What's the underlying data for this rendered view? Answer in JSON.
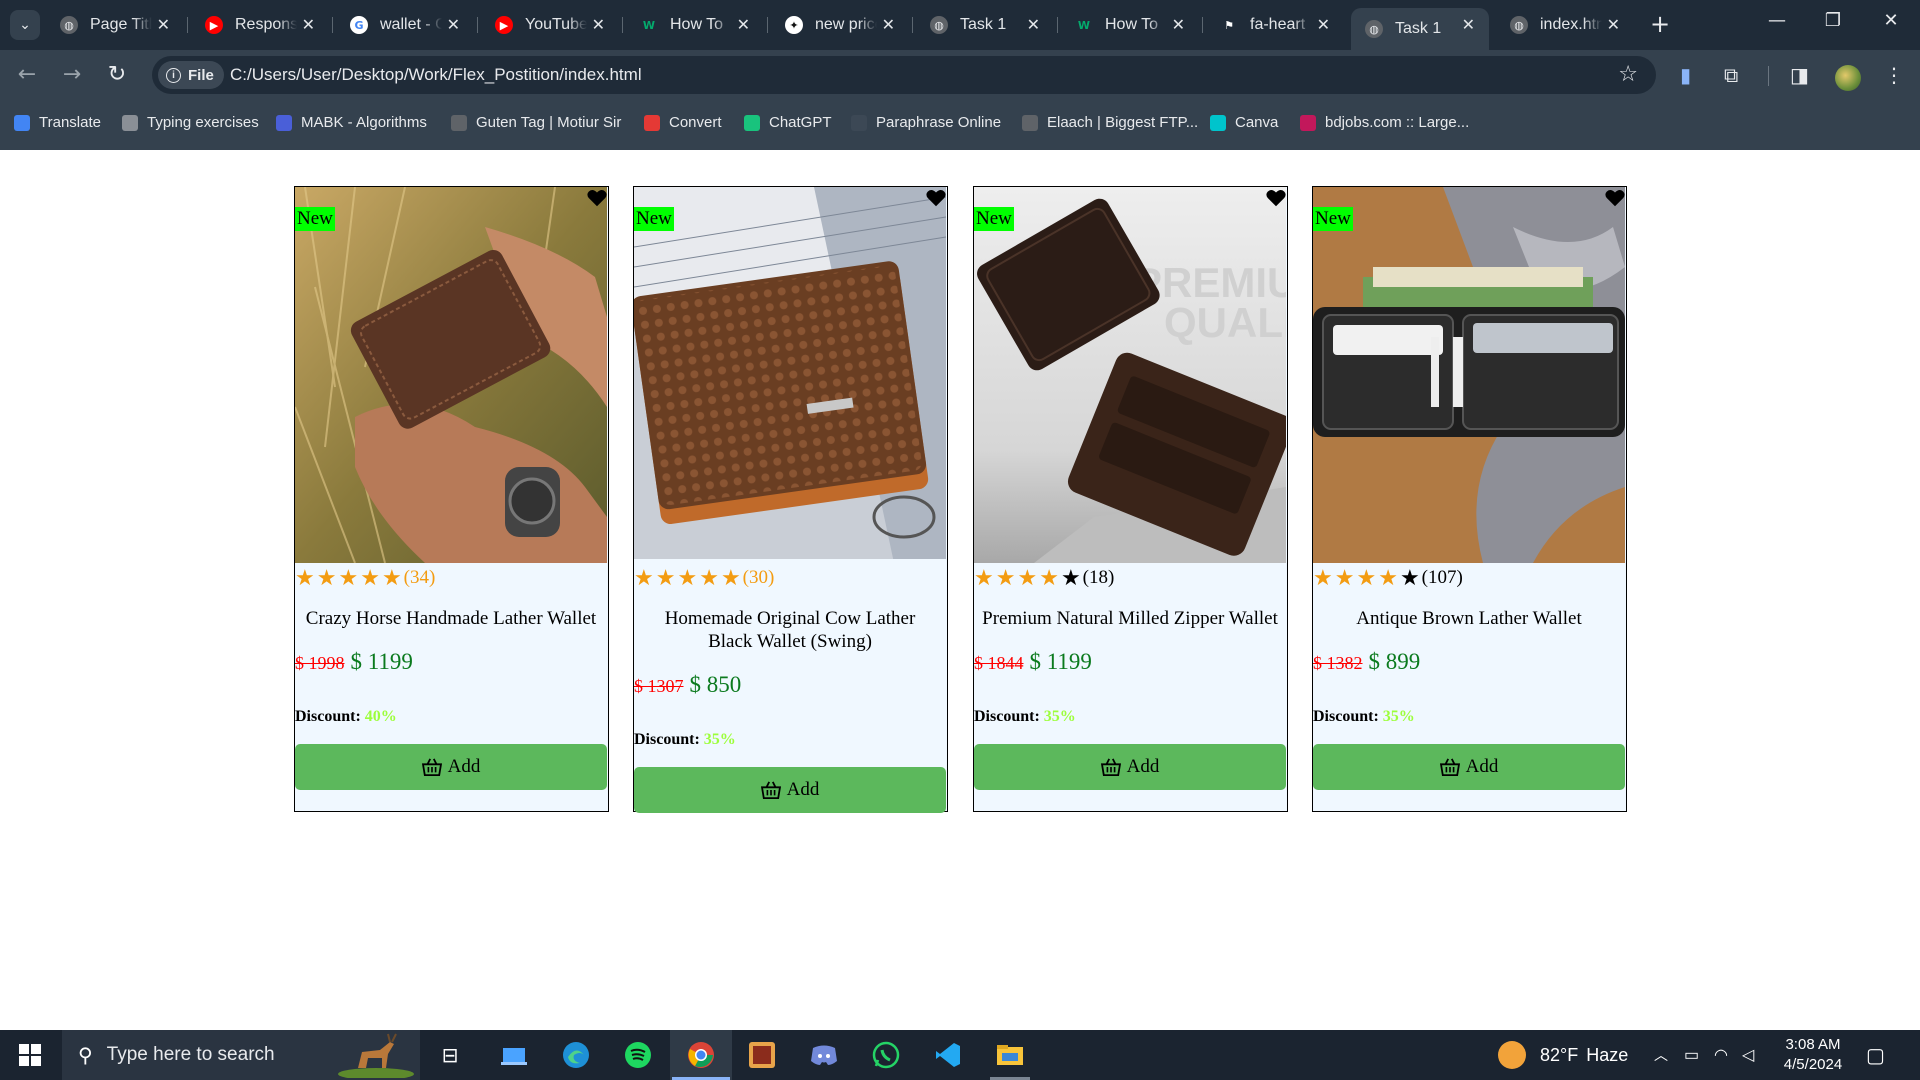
{
  "browser": {
    "tabs": [
      {
        "title": "Page Title",
        "favicon": "globe-icon",
        "active": false
      },
      {
        "title": "Responsive",
        "favicon": "youtube-icon",
        "active": false
      },
      {
        "title": "wallet - Google",
        "favicon": "google-icon",
        "active": false
      },
      {
        "title": "YouTube",
        "favicon": "youtube-icon",
        "active": false
      },
      {
        "title": "How To",
        "favicon": "w3schools-icon",
        "active": false
      },
      {
        "title": "new price",
        "favicon": "chatgpt-icon",
        "active": false
      },
      {
        "title": "Task 1",
        "favicon": "globe-icon",
        "active": false
      },
      {
        "title": "How To",
        "favicon": "w3schools-icon",
        "active": false
      },
      {
        "title": "fa-heart",
        "favicon": "flag-icon",
        "active": false
      },
      {
        "title": "Task 1",
        "favicon": "globe-icon",
        "active": true
      },
      {
        "title": "index.html",
        "favicon": "globe-icon",
        "active": false
      }
    ],
    "address": {
      "chip": "File",
      "url": "C:/Users/User/Desktop/Work/Flex_Postition/index.html"
    },
    "bookmarks": [
      {
        "label": "Translate",
        "icon": "translate-icon",
        "color": "#4285f4"
      },
      {
        "label": "Typing exercises",
        "icon": "keyboard-icon",
        "color": "#8a8f96"
      },
      {
        "label": "MABK - Algorithms",
        "icon": "mabk-icon",
        "color": "#4a5fd8"
      },
      {
        "label": "Guten Tag | Motiur Sir",
        "icon": "globe-icon",
        "color": "#5f6368"
      },
      {
        "label": "Convert",
        "icon": "convert-icon",
        "color": "#e53935"
      },
      {
        "label": "ChatGPT",
        "icon": "chatgpt-icon",
        "color": "#19c37d"
      },
      {
        "label": "Paraphrase Online",
        "icon": "paraphrase-icon",
        "color": "#3c4855"
      },
      {
        "label": "Elaach | Biggest FTP...",
        "icon": "globe-icon",
        "color": "#5f6368"
      },
      {
        "label": "Canva",
        "icon": "canva-icon",
        "color": "#00c4cc"
      },
      {
        "label": "bdjobs.com :: Large...",
        "icon": "bdjobs-icon",
        "color": "#c2185b"
      }
    ]
  },
  "products": [
    {
      "badge": "New",
      "stars": 5,
      "stars_orange": 5,
      "reviews": "(34)",
      "reviews_color": "#f39c12",
      "name": "Crazy Horse Handmade Lather Wallet",
      "old_price": "$ 1998",
      "new_price": "$ 1199",
      "discount_label": "Discount:",
      "discount_value": "40%",
      "button": "Add"
    },
    {
      "badge": "New",
      "stars": 5,
      "stars_orange": 5,
      "reviews": "(30)",
      "reviews_color": "#f39c12",
      "name": "Homemade Original Cow Lather Black Wallet (Swing)",
      "old_price": "$ 1307",
      "new_price": "$ 850",
      "discount_label": "Discount:",
      "discount_value": "35%",
      "button": "Add"
    },
    {
      "badge": "New",
      "stars": 5,
      "stars_orange": 4,
      "reviews": "(18)",
      "reviews_color": "#000000",
      "name": "Premium Natural Milled Zipper Wallet",
      "old_price": "$ 1844",
      "new_price": "$ 1199",
      "discount_label": "Discount:",
      "discount_value": "35%",
      "button": "Add"
    },
    {
      "badge": "New",
      "stars": 5,
      "stars_orange": 4,
      "reviews": "(107)",
      "reviews_color": "#000000",
      "name": "Antique Brown Lather Wallet",
      "old_price": "$ 1382",
      "new_price": "$ 899",
      "discount_label": "Discount:",
      "discount_value": "35%",
      "button": "Add"
    }
  ],
  "colors": {
    "star_filled": "#f39c12",
    "star_dark": "#000000",
    "old_price": "#ff0000",
    "new_price": "#0b7a1e",
    "discount_value": "#9dfe3c",
    "add_button": "#5cb85c",
    "new_badge": "#00ff00",
    "card_bg": "#f0f8ff"
  },
  "taskbar": {
    "search_placeholder": "Type here to search",
    "apps": [
      "task-view-icon",
      "file-manager-icon",
      "edge-icon",
      "spotify-icon",
      "chrome-icon",
      "app-icon",
      "discord-icon",
      "whatsapp-icon",
      "vscode-icon",
      "file-explorer-icon"
    ],
    "weather_temp": "82°F",
    "weather_text": "Haze",
    "time": "3:08 AM",
    "date": "4/5/2024"
  }
}
